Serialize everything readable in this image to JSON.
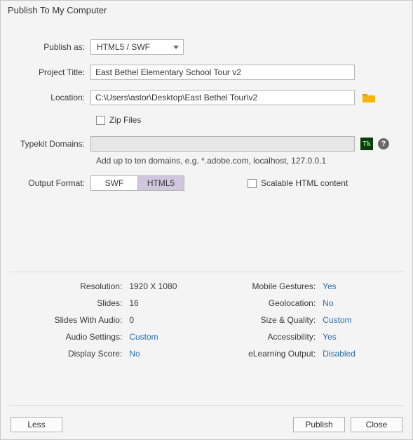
{
  "window": {
    "title": "Publish To My Computer"
  },
  "labels": {
    "publish_as": "Publish as:",
    "project_title": "Project Title:",
    "location": "Location:",
    "zip_files": "Zip Files",
    "typekit_domains": "Typekit Domains:",
    "typekit_hint": "Add up to ten domains, e.g. *.adobe.com, localhost, 127.0.0.1",
    "output_format": "Output Format:",
    "scalable": "Scalable HTML content"
  },
  "fields": {
    "publish_as_value": "HTML5 / SWF",
    "project_title_value": "East Bethel Elementary School Tour v2",
    "location_value": "C:\\Users\\astor\\Desktop\\East Bethel Tour\\v2",
    "typekit_value": "",
    "output_format_options": {
      "swf": "SWF",
      "html5": "HTML5"
    },
    "output_format_active": "html5"
  },
  "icons": {
    "tk": "Tk",
    "help": "?"
  },
  "summary": {
    "left": {
      "resolution_k": "Resolution:",
      "resolution_v": "1920 X 1080",
      "slides_k": "Slides:",
      "slides_v": "16",
      "slides_audio_k": "Slides With Audio:",
      "slides_audio_v": "0",
      "audio_settings_k": "Audio Settings:",
      "audio_settings_v": "Custom",
      "display_score_k": "Display Score:",
      "display_score_v": "No"
    },
    "right": {
      "mobile_k": "Mobile Gestures:",
      "mobile_v": "Yes",
      "geo_k": "Geolocation:",
      "geo_v": "No",
      "size_k": "Size & Quality:",
      "size_v": "Custom",
      "access_k": "Accessibility:",
      "access_v": "Yes",
      "elearn_k": "eLearning Output:",
      "elearn_v": "Disabled"
    }
  },
  "buttons": {
    "less": "Less",
    "publish": "Publish",
    "close": "Close"
  }
}
